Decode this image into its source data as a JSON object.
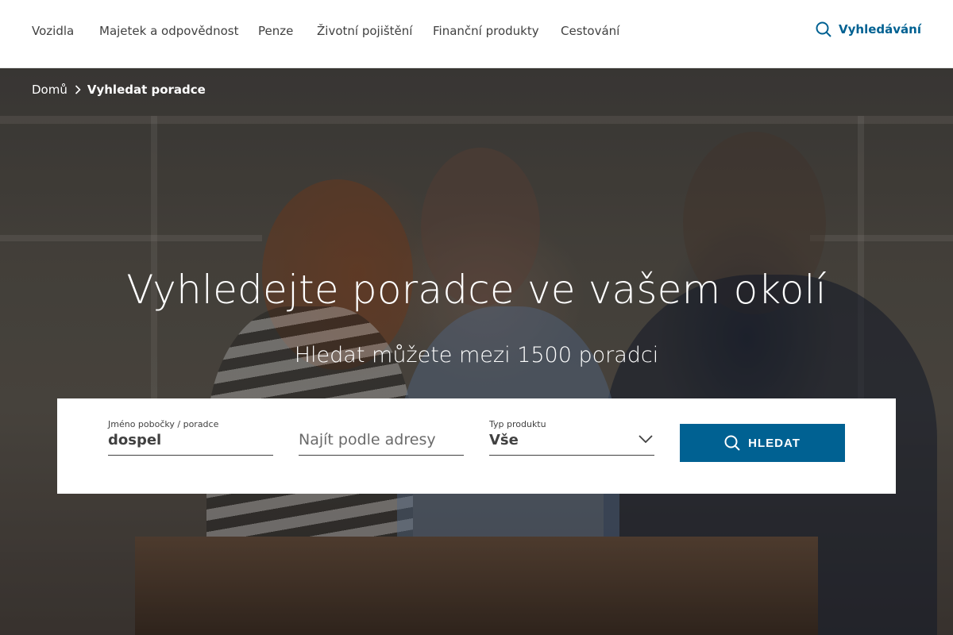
{
  "nav": {
    "items": [
      {
        "label": "Vozidla"
      },
      {
        "label": "Majetek a odpovědnost"
      },
      {
        "label": "Penze"
      },
      {
        "label": "Životní pojištění"
      },
      {
        "label": "Finanční produkty"
      },
      {
        "label": "Cestování"
      }
    ],
    "search_label": "Vyhledávání"
  },
  "breadcrumb": {
    "home": "Domů",
    "current": "Vyhledat poradce"
  },
  "hero": {
    "title": "Vyhledejte poradce ve vašem okolí",
    "subtitle": "Hledat můžete mezi 1500 poradci"
  },
  "search_form": {
    "name_field": {
      "label": "Jméno pobočky / poradce",
      "value": "dospel"
    },
    "address_field": {
      "placeholder": "Najít podle adresy"
    },
    "product_field": {
      "label": "Typ produktu",
      "value": "Vše"
    },
    "submit_label": "HLEDAT"
  },
  "colors": {
    "brand": "#006192",
    "text": "#414141"
  },
  "icons": {
    "search": "search-icon",
    "breadcrumb_separator": "chevron-right-icon",
    "dropdown": "chevron-down-icon"
  }
}
